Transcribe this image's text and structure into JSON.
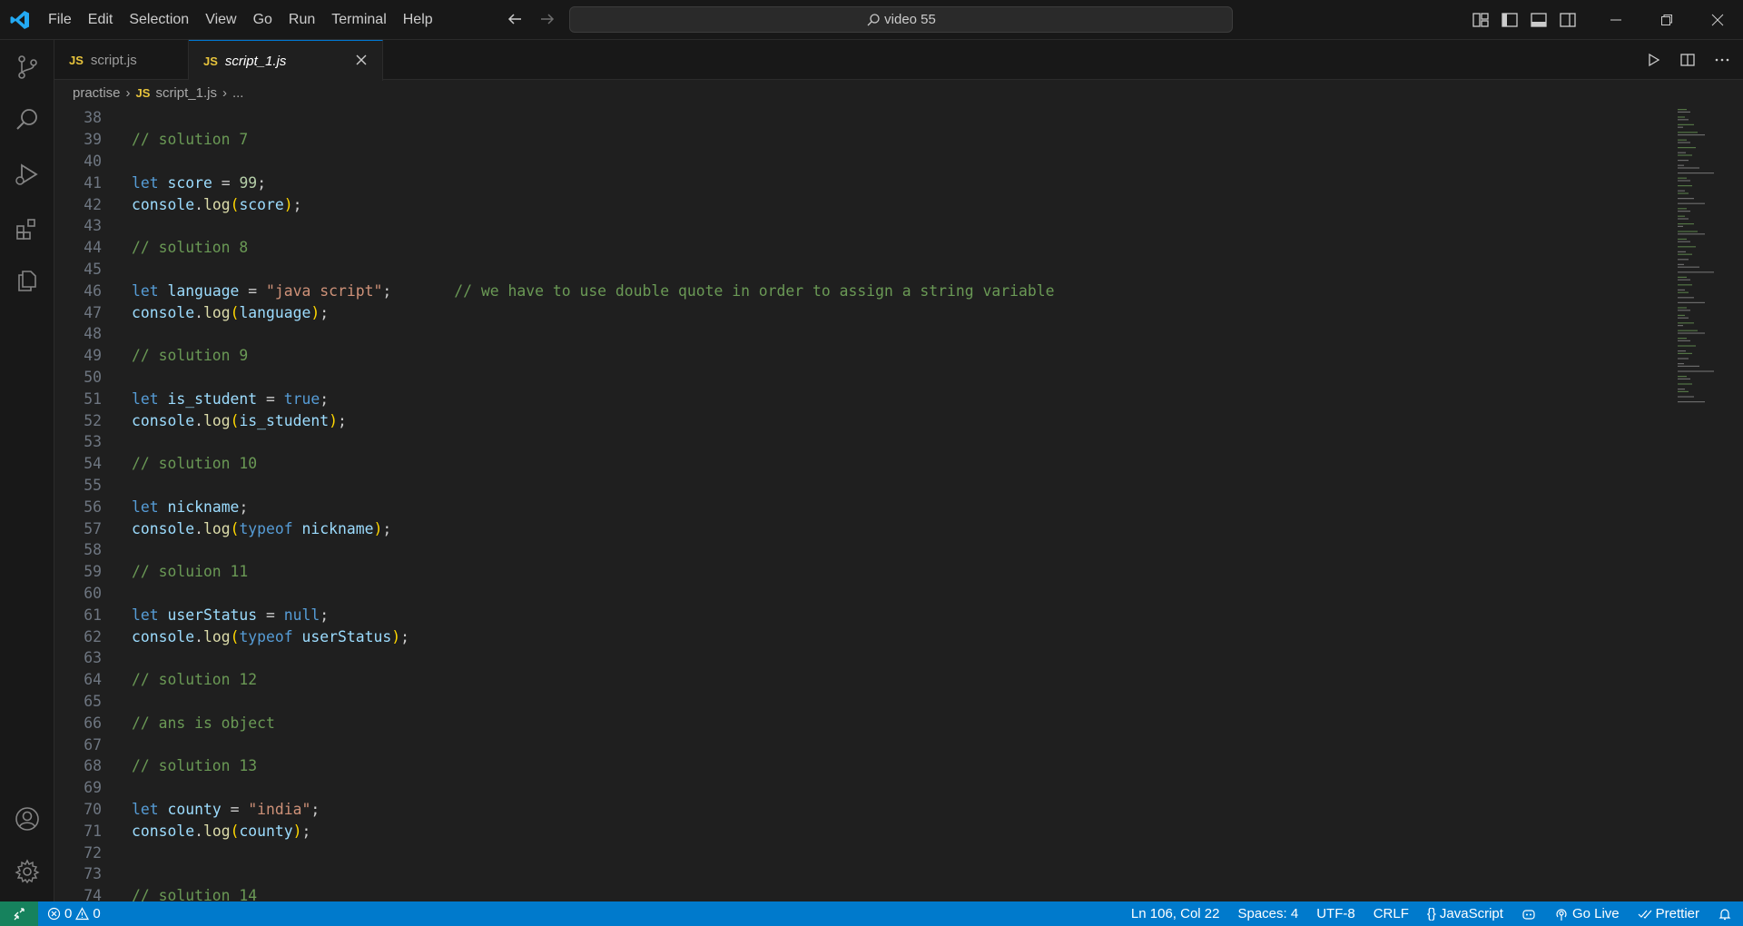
{
  "titlebar": {
    "menu": [
      "File",
      "Edit",
      "Selection",
      "View",
      "Go",
      "Run",
      "Terminal",
      "Help"
    ],
    "search_text": "video 55"
  },
  "tabs": [
    {
      "icon": "JS",
      "label": "script.js"
    },
    {
      "icon": "JS",
      "label": "script_1.js",
      "close": "×"
    }
  ],
  "breadcrumb": {
    "folder": "practise",
    "icon": "JS",
    "file": "script_1.js",
    "more": "..."
  },
  "code_lines": [
    {
      "n": "38",
      "t": ""
    },
    {
      "n": "39",
      "t": "// solution 7"
    },
    {
      "n": "40",
      "t": ""
    },
    {
      "n": "41",
      "t": "let score = 99;"
    },
    {
      "n": "42",
      "t": "console.log(score);"
    },
    {
      "n": "43",
      "t": ""
    },
    {
      "n": "44",
      "t": "// solution 8"
    },
    {
      "n": "45",
      "t": ""
    },
    {
      "n": "46",
      "t": "let language = \"java script\";       // we have to use double quote in order to assign a string variable"
    },
    {
      "n": "47",
      "t": "console.log(language);"
    },
    {
      "n": "48",
      "t": ""
    },
    {
      "n": "49",
      "t": "// solution 9"
    },
    {
      "n": "50",
      "t": ""
    },
    {
      "n": "51",
      "t": "let is_student = true;"
    },
    {
      "n": "52",
      "t": "console.log(is_student);"
    },
    {
      "n": "53",
      "t": ""
    },
    {
      "n": "54",
      "t": "// solution 10"
    },
    {
      "n": "55",
      "t": ""
    },
    {
      "n": "56",
      "t": "let nickname;"
    },
    {
      "n": "57",
      "t": "console.log(typeof nickname);"
    },
    {
      "n": "58",
      "t": ""
    },
    {
      "n": "59",
      "t": "// soluion 11"
    },
    {
      "n": "60",
      "t": ""
    },
    {
      "n": "61",
      "t": "let userStatus = null;"
    },
    {
      "n": "62",
      "t": "console.log(typeof userStatus);"
    },
    {
      "n": "63",
      "t": ""
    },
    {
      "n": "64",
      "t": "// solution 12"
    },
    {
      "n": "65",
      "t": ""
    },
    {
      "n": "66",
      "t": "// ans is object"
    },
    {
      "n": "67",
      "t": ""
    },
    {
      "n": "68",
      "t": "// solution 13"
    },
    {
      "n": "69",
      "t": ""
    },
    {
      "n": "70",
      "t": "let county = \"india\";"
    },
    {
      "n": "71",
      "t": "console.log(county);"
    },
    {
      "n": "72",
      "t": ""
    },
    {
      "n": "73",
      "t": ""
    },
    {
      "n": "74",
      "t": "// solution 14"
    }
  ],
  "statusbar": {
    "errors": "0",
    "warnings": "0",
    "position": "Ln 106, Col 22",
    "spaces": "Spaces: 4",
    "encoding": "UTF-8",
    "eol": "CRLF",
    "language": "JavaScript",
    "golive": "Go Live",
    "prettier": "Prettier"
  },
  "colors": {
    "accent": "#007acc",
    "keyword": "#569cd6",
    "variable": "#9cdcfe",
    "function": "#dcdcaa",
    "string": "#ce9178",
    "number": "#b5cea8",
    "comment": "#6a9955",
    "bracket": "#ffd700",
    "js_icon": "#e8c43c"
  }
}
